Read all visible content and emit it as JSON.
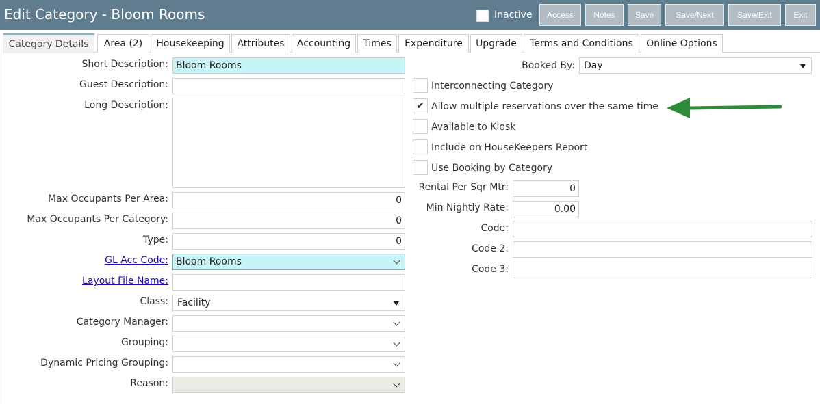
{
  "header": {
    "title": "Edit Category - Bloom Rooms",
    "inactive_label": "Inactive",
    "buttons": [
      "Access",
      "Notes",
      "Save",
      "Save/Next",
      "Save/Exit",
      "Exit"
    ]
  },
  "tabs": [
    "Category Details",
    "Area (2)",
    "Housekeeping",
    "Attributes",
    "Accounting",
    "Times",
    "Expenditure",
    "Upgrade",
    "Terms and Conditions",
    "Online Options"
  ],
  "left": {
    "short_description": {
      "label": "Short Description:",
      "value": "Bloom Rooms"
    },
    "guest_description": {
      "label": "Guest Description:",
      "value": ""
    },
    "long_description": {
      "label": "Long Description:",
      "value": ""
    },
    "max_occ_area": {
      "label": "Max Occupants Per Area:",
      "value": "0"
    },
    "max_occ_category": {
      "label": "Max Occupants Per Category:",
      "value": "0"
    },
    "type": {
      "label": "Type:",
      "value": "0"
    },
    "gl_acc_code": {
      "label": "GL Acc Code:",
      "value": "Bloom Rooms"
    },
    "layout_file": {
      "label": "Layout File Name:",
      "value": ""
    },
    "class": {
      "label": "Class:",
      "value": "Facility"
    },
    "category_manager": {
      "label": "Category Manager:",
      "value": ""
    },
    "grouping": {
      "label": "Grouping:",
      "value": ""
    },
    "dynamic_pricing": {
      "label": "Dynamic Pricing Grouping:",
      "value": ""
    },
    "reason": {
      "label": "Reason:",
      "value": ""
    }
  },
  "right": {
    "booked_by": {
      "label": "Booked By:",
      "value": "Day"
    },
    "checkboxes": [
      {
        "label": "Interconnecting Category",
        "checked": false
      },
      {
        "label": "Allow multiple reservations over the same time",
        "checked": true
      },
      {
        "label": "Available to Kiosk",
        "checked": false
      },
      {
        "label": "Include on HouseKeepers Report",
        "checked": false
      },
      {
        "label": "Use Booking by Category",
        "checked": false
      }
    ],
    "check_mark": "✔",
    "rental_per_sqm": {
      "label": "Rental Per Sqr Mtr:",
      "value": "0"
    },
    "min_nightly_rate": {
      "label": "Min Nightly Rate:",
      "value": "0.00"
    },
    "code": {
      "label": "Code:",
      "value": ""
    },
    "code2": {
      "label": "Code 2:",
      "value": ""
    },
    "code3": {
      "label": "Code 3:",
      "value": ""
    }
  },
  "colors": {
    "header_bg": "#607d8f",
    "highlight_field": "#c9f4f7",
    "arrow": "#2e8b3a"
  }
}
